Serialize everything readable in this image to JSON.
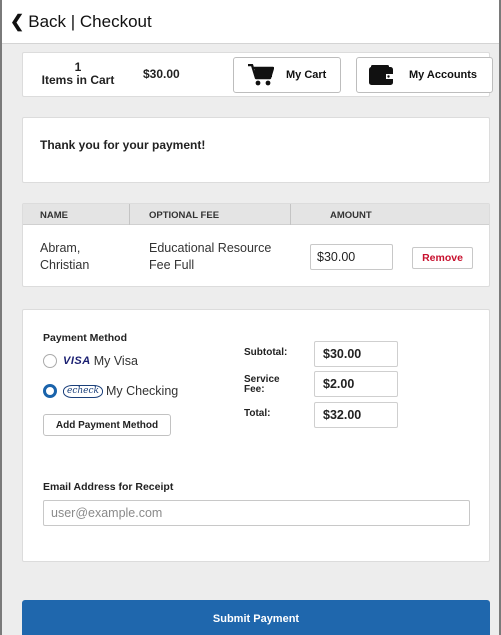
{
  "header": {
    "back_label": "Back | Checkout"
  },
  "cart": {
    "count": "1",
    "count_label": "Items in Cart",
    "total": "$30.00",
    "my_cart_label": "My Cart",
    "my_accounts_label": "My Accounts"
  },
  "thanks": {
    "message": "Thank you for your payment!"
  },
  "table": {
    "columns": [
      "NAME",
      "OPTIONAL FEE",
      "AMOUNT"
    ],
    "rows": [
      {
        "name_line1": "Abram,",
        "name_line2": "Christian",
        "fee_line1": "Educational Resource",
        "fee_line2": "Fee Full",
        "amount": "$30.00",
        "remove_label": "Remove"
      }
    ]
  },
  "payment": {
    "method_label": "Payment Method",
    "methods": [
      {
        "logo": "VISA",
        "label": "My Visa",
        "selected": false
      },
      {
        "logo": "echeck",
        "label": "My Checking",
        "selected": true
      }
    ],
    "add_method_label": "Add Payment Method",
    "subtotal_label": "Subtotal:",
    "subtotal": "$30.00",
    "service_fee_label_line1": "Service",
    "service_fee_label_line2": "Fee:",
    "service_fee": "$2.00",
    "total_label": "Total:",
    "total": "$32.00",
    "email_label": "Email Address for Receipt",
    "email_placeholder": "user@example.com"
  },
  "submit": {
    "label": "Submit Payment"
  },
  "colors": {
    "primary": "#1f67ad",
    "remove_red": "#c8102e",
    "radio_checked": "#1a63ab"
  },
  "icons": {
    "back": "chevron-left-icon",
    "cart": "shopping-cart-icon",
    "accounts": "wallet-icon"
  }
}
